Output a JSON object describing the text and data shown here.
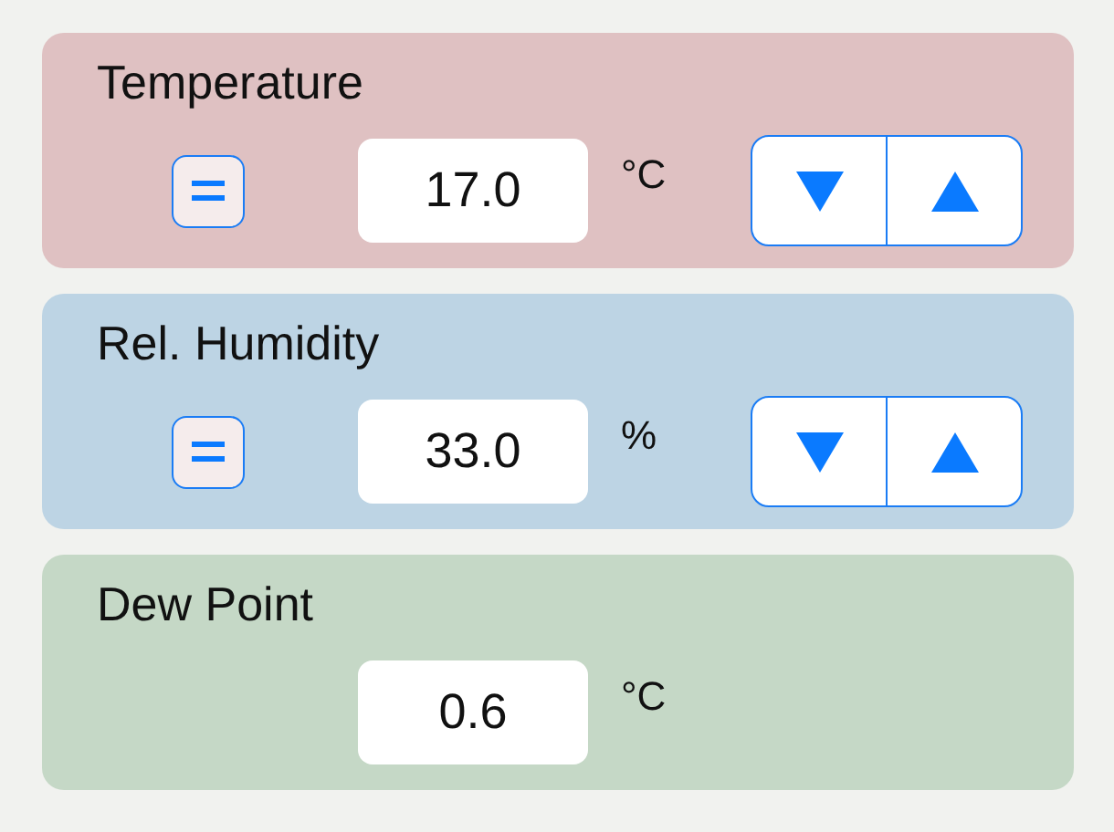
{
  "cards": [
    {
      "kind": "input",
      "title": "Temperature",
      "value": "17.0",
      "unit": "°C",
      "color": "#dfc1c2"
    },
    {
      "kind": "input",
      "title": "Rel. Humidity",
      "value": "33.0",
      "unit": "%",
      "color": "#bdd4e4"
    },
    {
      "kind": "result",
      "title": "Dew Point",
      "value": "0.6",
      "unit": "°C",
      "color": "#c5d8c6"
    }
  ]
}
